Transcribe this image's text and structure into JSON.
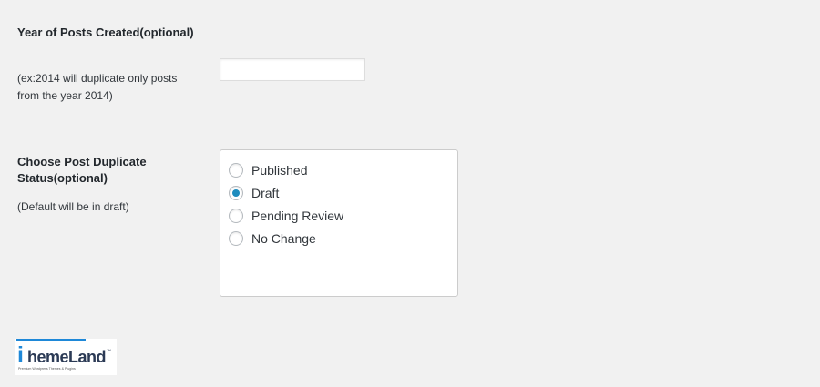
{
  "year_field": {
    "title": "Year of Posts Created(optional)",
    "description": "(ex:2014 will duplicate only posts from the year 2014)",
    "value": "",
    "placeholder": ""
  },
  "status_field": {
    "title": "Choose Post Duplicate Status(optional)",
    "description": "(Default will be in draft)",
    "options": [
      {
        "label": "Published",
        "checked": false
      },
      {
        "label": "Draft",
        "checked": true
      },
      {
        "label": "Pending Review",
        "checked": false
      },
      {
        "label": "No Change",
        "checked": false
      }
    ]
  },
  "logo": {
    "i": "i",
    "text": "hemeLand",
    "tm": "™",
    "tagline": "Premium Wordpress Themes & Plugins"
  },
  "colors": {
    "accent": "#1e8cbe",
    "brand": "#1e88d8",
    "background": "#f1f1f1"
  }
}
